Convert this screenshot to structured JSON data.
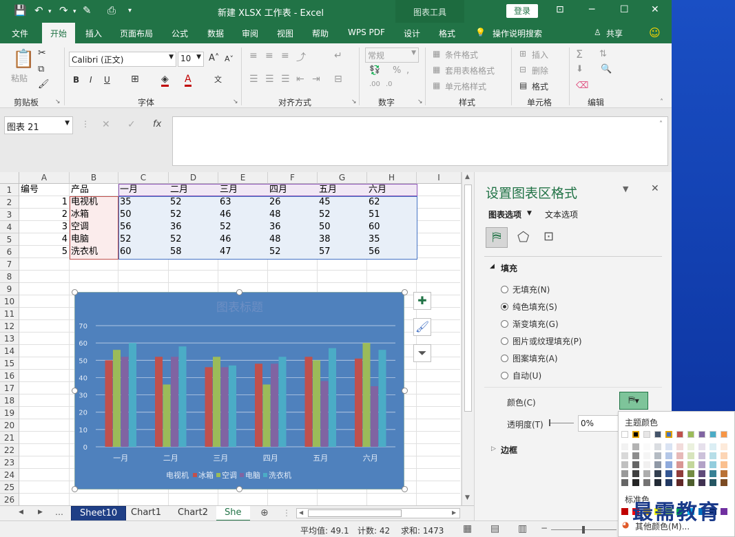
{
  "window": {
    "title": "新建 XLSX 工作表  -  Excel",
    "context_tool": "图表工具",
    "login": "登录"
  },
  "tabs": [
    "文件",
    "开始",
    "插入",
    "页面布局",
    "公式",
    "数据",
    "审阅",
    "视图",
    "帮助",
    "WPS PDF",
    "设计",
    "格式"
  ],
  "active_tab": "开始",
  "tell_me": "操作说明搜索",
  "share": "共享",
  "ribbon": {
    "clipboard": {
      "label": "剪贴板",
      "paste": "粘贴"
    },
    "font": {
      "label": "字体",
      "name": "Calibri (正文)",
      "size": "10",
      "bold": "B",
      "italic": "I",
      "underline": "U"
    },
    "alignment": {
      "label": "对齐方式"
    },
    "number": {
      "label": "数字",
      "format": "常规"
    },
    "styles": {
      "label": "样式",
      "conditional": "条件格式",
      "table": "套用表格格式",
      "cell": "单元格样式"
    },
    "cells": {
      "label": "单元格",
      "insert": "插入",
      "delete": "删除",
      "format": "格式"
    },
    "editing": {
      "label": "编辑"
    }
  },
  "namebox": "图表 21",
  "fx": "fx",
  "columns": [
    "A",
    "B",
    "C",
    "D",
    "E",
    "F",
    "G",
    "H",
    "I"
  ],
  "rows": [
    "1",
    "2",
    "3",
    "4",
    "5",
    "6",
    "7",
    "8",
    "9",
    "10",
    "11",
    "12",
    "13",
    "14",
    "15",
    "16",
    "17",
    "18",
    "19",
    "20",
    "21",
    "22",
    "23",
    "24",
    "25",
    "26"
  ],
  "table": {
    "header": [
      "编号",
      "产品",
      "一月",
      "二月",
      "三月",
      "四月",
      "五月",
      "六月"
    ],
    "rows": [
      [
        "1",
        "电视机",
        "35",
        "52",
        "63",
        "26",
        "45",
        "62"
      ],
      [
        "2",
        "冰箱",
        "50",
        "52",
        "46",
        "48",
        "52",
        "51"
      ],
      [
        "3",
        "空调",
        "56",
        "36",
        "52",
        "36",
        "50",
        "60"
      ],
      [
        "4",
        "电脑",
        "52",
        "52",
        "46",
        "48",
        "38",
        "35"
      ],
      [
        "5",
        "洗衣机",
        "60",
        "58",
        "47",
        "52",
        "57",
        "56"
      ]
    ]
  },
  "sheet_tabs": [
    "Sheet10",
    "Chart1",
    "Chart2",
    "She"
  ],
  "status": {
    "avg": "平均值: 49.1",
    "count": "计数: 42",
    "sum": "求和: 1473"
  },
  "pane": {
    "title": "设置图表区格式",
    "tab1": "图表选项",
    "tab2": "文本选项",
    "fill_section": "填充",
    "options": [
      "无填充(N)",
      "纯色填充(S)",
      "渐变填充(G)",
      "图片或纹理填充(P)",
      "图案填充(A)",
      "自动(U)"
    ],
    "selected": 1,
    "color_label": "颜色(C)",
    "transparency_label": "透明度(T)",
    "transparency_value": "0%",
    "border_section": "边框"
  },
  "palette": {
    "theme_label": "主题颜色",
    "standard_label": "标准色",
    "more": "其他颜色(M)...",
    "theme_top": [
      "#ffffff",
      "#000000",
      "#e7e6e6",
      "#44546a",
      "#4472c4",
      "#c0504d",
      "#9bbb59",
      "#8064a2",
      "#4bacc6",
      "#f79646"
    ],
    "standard": [
      "#c00000",
      "#ff0000",
      "#ffc000",
      "#ffff00",
      "#92d050",
      "#00b050",
      "#00b0f0",
      "#0070c0",
      "#002060",
      "#7030a0"
    ]
  },
  "watermark": "最需教育",
  "colors": {
    "excel_green": "#217346",
    "chart_bg": "#4f81bd"
  },
  "chart_data": {
    "type": "bar",
    "title": "图表标题",
    "categories": [
      "一月",
      "二月",
      "三月",
      "四月",
      "五月",
      "六月"
    ],
    "series": [
      {
        "name": "电视机",
        "color": "#c0504d",
        "values": [
          50,
          52,
          46,
          48,
          52,
          51
        ]
      },
      {
        "name": "冰箱",
        "color": "#9bbb59",
        "values": [
          56,
          36,
          52,
          36,
          50,
          60
        ]
      },
      {
        "name": "空调",
        "color": "#8064a2",
        "values": [
          52,
          52,
          46,
          48,
          38,
          35
        ]
      },
      {
        "name": "电脑",
        "color": "#4bacc6",
        "values": [
          60,
          58,
          47,
          52,
          57,
          56
        ]
      }
    ],
    "legend": [
      "电视机",
      "冰箱",
      "空调",
      "电脑",
      "洗衣机"
    ],
    "yticks": [
      "0",
      "10",
      "20",
      "30",
      "40",
      "50",
      "60",
      "70"
    ],
    "ylim": [
      0,
      70
    ],
    "grid": true,
    "legend_position": "bottom"
  }
}
